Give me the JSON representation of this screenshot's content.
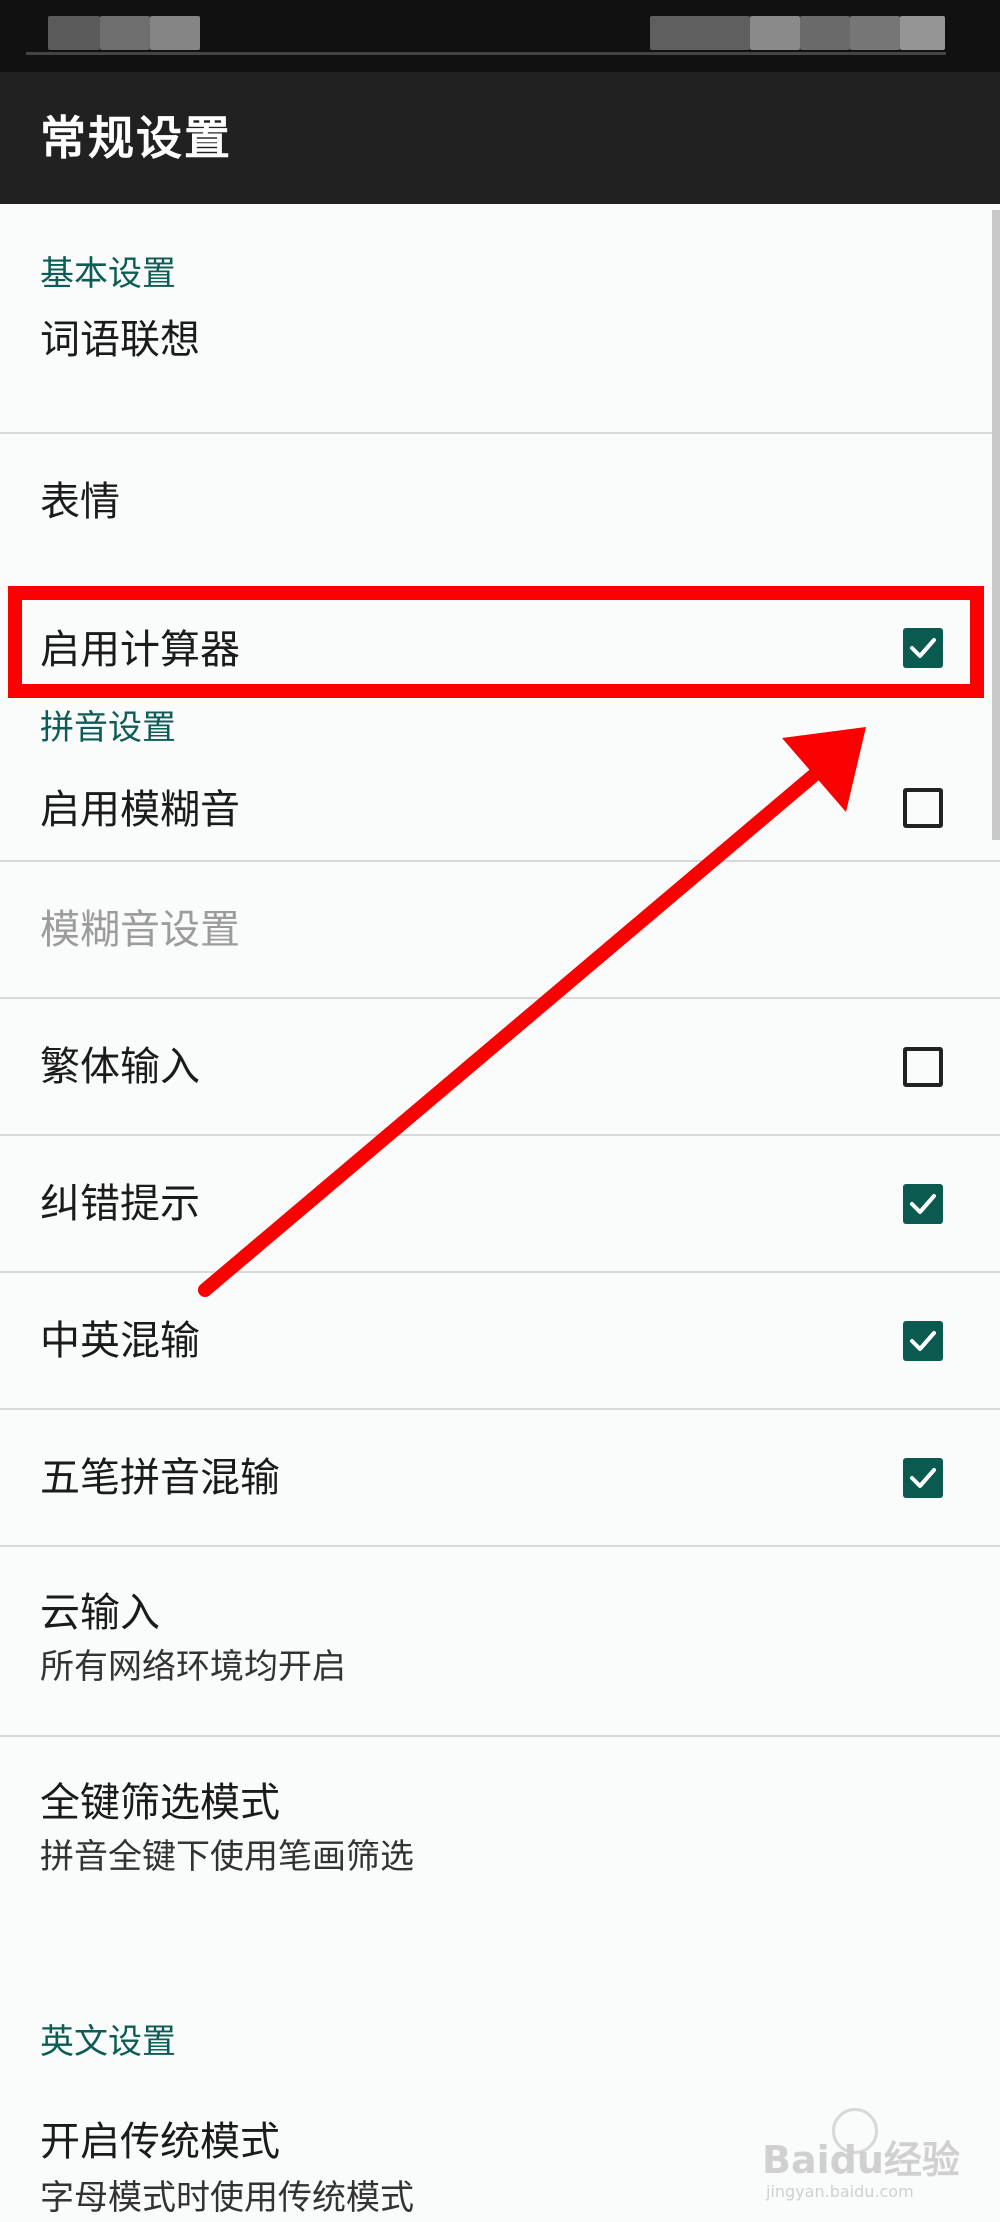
{
  "app_bar": {
    "title": "常规设置"
  },
  "sections": {
    "basic": "基本设置",
    "pinyin": "拼音设置",
    "english": "英文设置"
  },
  "items": {
    "word_association": {
      "label": "词语联想"
    },
    "emoji": {
      "label": "表情"
    },
    "calculator": {
      "label": "启用计算器",
      "checked": true
    },
    "fuzzy_pinyin": {
      "label": "启用模糊音",
      "checked": false
    },
    "fuzzy_settings": {
      "label": "模糊音设置",
      "enabled": false
    },
    "traditional_input": {
      "label": "繁体输入",
      "checked": false
    },
    "error_hint": {
      "label": "纠错提示",
      "checked": true
    },
    "cn_en_mixed": {
      "label": "中英混输",
      "checked": true
    },
    "wubi_pinyin_mixed": {
      "label": "五笔拼音混输",
      "checked": true
    },
    "cloud_input": {
      "label": "云输入",
      "summary": "所有网络环境均开启"
    },
    "full_key_filter": {
      "label": "全键筛选模式",
      "summary": "拼音全键下使用笔画筛选"
    },
    "traditional_mode": {
      "label": "开启传统模式",
      "summary": "字母模式时使用传统模式"
    }
  },
  "annotation": {
    "highlight_color": "#fb0000"
  },
  "watermark": {
    "brand": "Baidu经验",
    "url": "jingyan.baidu.com"
  },
  "colors": {
    "accent": "#0b5a50",
    "section_header": "#0d5c55",
    "app_bar": "#212121"
  }
}
